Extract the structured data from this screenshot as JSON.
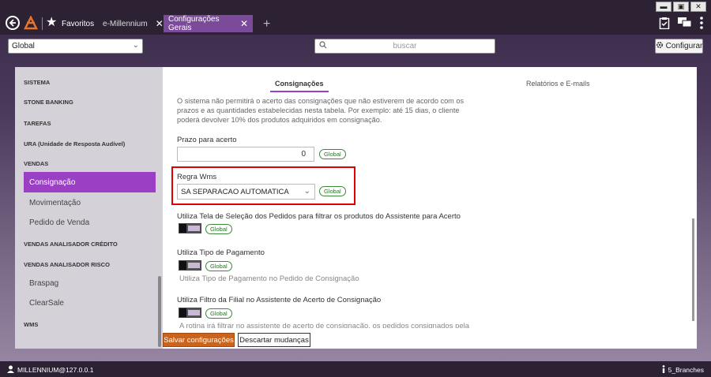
{
  "window": {
    "minimize": "▬",
    "maximize": "▣",
    "close": "✕"
  },
  "nav": {
    "back_icon": "arrow-left-icon",
    "favorites_label": "Favoritos"
  },
  "tabs": [
    {
      "label": "e-Millennium",
      "close": "✕",
      "active": false
    },
    {
      "label": "Configurações Gerais",
      "close": "✕",
      "active": true
    }
  ],
  "tab_add": "+",
  "toolbar": {
    "scope_value": "Global",
    "search_placeholder": "buscar",
    "config_label": "Configurar"
  },
  "sidebar": {
    "items": [
      {
        "label": "SISTEMA",
        "type": "header"
      },
      {
        "label": "STONE BANKING",
        "type": "header"
      },
      {
        "label": "TAREFAS",
        "type": "header"
      },
      {
        "label": "URA (Unidade de Resposta Audível)",
        "type": "header"
      },
      {
        "label": "VENDAS",
        "type": "header"
      },
      {
        "label": "Consignação",
        "type": "sub",
        "active": true
      },
      {
        "label": "Movimentação",
        "type": "sub"
      },
      {
        "label": "Pedido de Venda",
        "type": "sub"
      },
      {
        "label": "VENDAS ANALISADOR CRÉDITO",
        "type": "header"
      },
      {
        "label": "VENDAS ANALISADOR RISCO",
        "type": "header"
      },
      {
        "label": "Braspag",
        "type": "sub"
      },
      {
        "label": "ClearSale",
        "type": "sub"
      },
      {
        "label": "WMS",
        "type": "header"
      }
    ]
  },
  "main": {
    "tabs": [
      {
        "label": "Consignações",
        "active": true
      },
      {
        "label": "Relatórios e E-mails",
        "active": false
      }
    ],
    "description": "O sistema não permitirá o acerto das consignações que não estiverem de acordo com os prazos e as quantidades estabelecidas nesta tabela. Por exemplo: até 15 dias, o cliente poderá devolver 10% dos produtos adquiridos em consignação.",
    "prazo": {
      "label": "Prazo para acerto",
      "value": "0",
      "badge": "Global"
    },
    "regra_wms": {
      "label": "Regra Wms",
      "value": "SA SEPARACAO AUTOMATICA",
      "badge": "Global"
    },
    "tela_selecao": {
      "label": "Utiliza Tela de Seleção dos Pedidos para filtrar os produtos do Assistente para Acerto",
      "badge": "Global"
    },
    "tipo_pagamento": {
      "label": "Utiliza Tipo de Pagamento",
      "badge": "Global",
      "description": "Utiliza Tipo de Pagamento no Pedido de Consignação"
    },
    "filtro_filial": {
      "label": "Utiliza Filtro da Filial no Assistente de Acerto de Consignação",
      "badge": "Global",
      "description": "A rotina irá filtrar no assistente de acerto de consignação, os pedidos consignados pela"
    },
    "save_label": "Salvar configurações",
    "discard_label": "Descartar mudanças"
  },
  "status": {
    "user": "MILLENNIUM@127.0.0.1",
    "branch": "5_Branches"
  }
}
